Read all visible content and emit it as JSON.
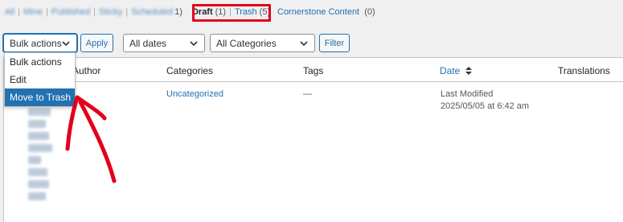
{
  "status_links": {
    "blurred": [
      "All",
      "Mine",
      "Published",
      "Sticky",
      "Scheduled"
    ],
    "blurred_last_count": "1)",
    "draft": {
      "label": "Draft",
      "count": "(1)"
    },
    "trash": {
      "label": "Trash",
      "count": "(5)"
    },
    "cornerstone": {
      "label": "Cornerstone Content",
      "count": "(0)"
    },
    "separator": "|"
  },
  "tablenav": {
    "bulk_actions_label": "Bulk actions",
    "apply_label": "Apply",
    "dates_label": "All dates",
    "categories_label": "All Categories",
    "filter_label": "Filter"
  },
  "bulk_dropdown": {
    "items": [
      {
        "label": "Bulk actions",
        "selected": false
      },
      {
        "label": "Edit",
        "selected": false
      },
      {
        "label": "Move to Trash",
        "selected": true
      }
    ]
  },
  "table": {
    "headers": {
      "author": "Author",
      "categories": "Categories",
      "tags": "Tags",
      "date": "Date",
      "translations": "Translations"
    },
    "row": {
      "category": "Uncategorized",
      "tags": "—",
      "date_status": "Last Modified",
      "date_value": "2025/05/05 at 6:42 am"
    }
  },
  "colors": {
    "link": "#2271b1",
    "highlight": "#e3001b",
    "annotation_arrow": "#e3001b",
    "selected_bg": "#2271b1"
  },
  "icons": {
    "select_chevron": "chevron-down-icon",
    "sort": "sort-arrows-icon",
    "annotation": "red-arrow-annotation"
  }
}
